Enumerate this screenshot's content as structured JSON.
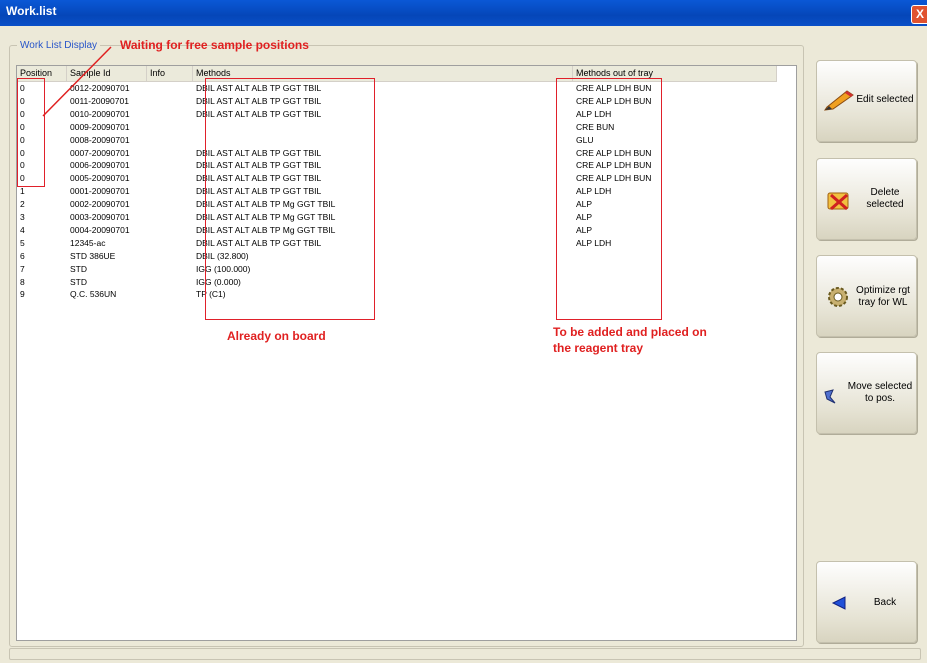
{
  "window": {
    "title": "Work.list",
    "close_glyph": "X"
  },
  "group": {
    "label": "Work List Display"
  },
  "columns": [
    "Position",
    "Sample Id",
    "Info",
    "Methods",
    "Methods out of tray"
  ],
  "rows": [
    {
      "position": "0",
      "sample_id": "0012-20090701",
      "info": "",
      "methods": "DBIL AST ALT ALB TP GGT TBIL",
      "out_of_tray": "CRE ALP LDH BUN"
    },
    {
      "position": "0",
      "sample_id": "0011-20090701",
      "info": "",
      "methods": "DBIL AST ALT ALB TP GGT TBIL",
      "out_of_tray": "CRE ALP LDH BUN"
    },
    {
      "position": "0",
      "sample_id": "0010-20090701",
      "info": "",
      "methods": "DBIL AST ALT ALB TP GGT TBIL",
      "out_of_tray": "ALP LDH"
    },
    {
      "position": "0",
      "sample_id": "0009-20090701",
      "info": "",
      "methods": "",
      "out_of_tray": "CRE BUN"
    },
    {
      "position": "0",
      "sample_id": "0008-20090701",
      "info": "",
      "methods": "",
      "out_of_tray": "GLU"
    },
    {
      "position": "0",
      "sample_id": "0007-20090701",
      "info": "",
      "methods": "DBIL AST ALT ALB TP GGT TBIL",
      "out_of_tray": "CRE ALP LDH BUN"
    },
    {
      "position": "0",
      "sample_id": "0006-20090701",
      "info": "",
      "methods": "DBIL AST ALT ALB TP GGT TBIL",
      "out_of_tray": "CRE ALP LDH BUN"
    },
    {
      "position": "0",
      "sample_id": "0005-20090701",
      "info": "",
      "methods": "DBIL AST ALT ALB TP GGT TBIL",
      "out_of_tray": "CRE ALP LDH BUN"
    },
    {
      "position": "1",
      "sample_id": "0001-20090701",
      "info": "",
      "methods": "DBIL AST ALT ALB TP GGT TBIL",
      "out_of_tray": "ALP LDH"
    },
    {
      "position": "2",
      "sample_id": "0002-20090701",
      "info": "",
      "methods": "DBIL AST ALT ALB TP Mg GGT TBIL",
      "out_of_tray": "ALP"
    },
    {
      "position": "3",
      "sample_id": "0003-20090701",
      "info": "",
      "methods": "DBIL AST ALT ALB TP Mg GGT TBIL",
      "out_of_tray": "ALP"
    },
    {
      "position": "4",
      "sample_id": "0004-20090701",
      "info": "",
      "methods": "DBIL AST ALT ALB TP Mg GGT TBIL",
      "out_of_tray": "ALP"
    },
    {
      "position": "5",
      "sample_id": "12345-ac",
      "info": "",
      "methods": "DBIL AST ALT ALB TP GGT TBIL",
      "out_of_tray": "ALP LDH"
    },
    {
      "position": "6",
      "sample_id": "STD 386UE",
      "info": "",
      "methods": "DBIL (32.800)",
      "out_of_tray": ""
    },
    {
      "position": "7",
      "sample_id": "STD",
      "info": "",
      "methods": "IGG (100.000)",
      "out_of_tray": ""
    },
    {
      "position": "8",
      "sample_id": "STD",
      "info": "",
      "methods": "IGG (0.000)",
      "out_of_tray": ""
    },
    {
      "position": "9",
      "sample_id": "Q.C. 536UN",
      "info": "",
      "methods": "TP (C1)",
      "out_of_tray": ""
    }
  ],
  "annotations": {
    "waiting": "Waiting for free sample positions",
    "on_board": "Already on board",
    "to_be_added_1": "To be added and placed on",
    "to_be_added_2": "the reagent tray",
    "color": "#e02020"
  },
  "buttons": {
    "edit": "Edit selected",
    "delete_1": "Delete",
    "delete_2": "selected",
    "optimize_1": "Optimize rgt",
    "optimize_2": "tray for WL",
    "move_1": "Move selected",
    "move_2": "to pos.",
    "back": "Back"
  },
  "icons": {
    "edit": "pencil-icon",
    "delete": "delete-icon",
    "optimize": "gear-icon",
    "move": "move-arrow-icon",
    "back": "back-arrow-icon"
  }
}
